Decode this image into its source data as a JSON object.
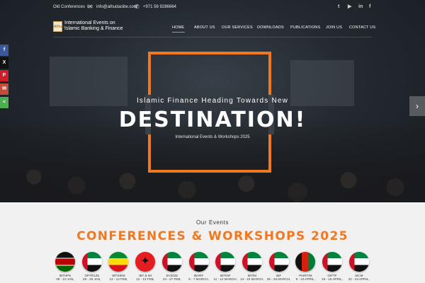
{
  "topbar": {
    "old_conferences": "Old Conferences",
    "old_conferences_caret": "⇩",
    "email": "info@alhudacibe.com",
    "phone": "+971 56 9286664",
    "social_icons": [
      "twitter-icon",
      "youtube-icon",
      "linkedin-icon",
      "facebook-icon"
    ],
    "social_glyphs": [
      "t",
      "▶",
      "in",
      "f"
    ]
  },
  "header": {
    "logo_text": "AlHuda",
    "title_line1": "International Events on",
    "title_line2": "Islamic Banking & Finance"
  },
  "nav": {
    "items": [
      "HOME",
      "ABOUT US",
      "OUR SERVICES",
      "DOWNLOADS",
      "PUBLICATIONS",
      "JOIN US",
      "CONTACT US"
    ],
    "active": "HOME"
  },
  "share": {
    "items": [
      {
        "icon": "facebook-icon",
        "glyph": "f",
        "color": "#3b5998"
      },
      {
        "icon": "x-twitter-icon",
        "glyph": "X",
        "color": "#111111"
      },
      {
        "icon": "pinterest-icon",
        "glyph": "P",
        "color": "#cb2027"
      },
      {
        "icon": "email-icon",
        "glyph": "✉",
        "color": "#c44c3a"
      },
      {
        "icon": "share-icon",
        "glyph": "<",
        "color": "#4caf50"
      }
    ]
  },
  "hero": {
    "subtitle": "Islamic Finance Heading Towards New",
    "title": "DESTINATION!",
    "caption": "International Events & Workshops 2025",
    "next_arrow": "›"
  },
  "events": {
    "kicker": "Our Events",
    "title": "CONFERENCES & WORKSHOPS 2025",
    "items": [
      {
        "code": "IBTHPS",
        "date": "09 - 10 JAN,",
        "flag": "kenya"
      },
      {
        "code": "OPTR125",
        "date": "28 - 29 JAN,",
        "flag": "uae"
      },
      {
        "code": "IBTSIEM",
        "date": "13 - 14 FEB,",
        "flag": "eth"
      },
      {
        "code": "IBT & IM",
        "date": "12 - 13 FEB,",
        "flag": "alb"
      },
      {
        "code": "EV2025",
        "date": "24 - 27 FEB,",
        "flag": "uae"
      },
      {
        "code": "IBARF",
        "date": "6 - 7 MARCH,",
        "flag": "uae"
      },
      {
        "code": "IBTINF",
        "date": "11 - 12 MARCH,",
        "flag": "uae"
      },
      {
        "code": "IBTIM",
        "date": "14 - 15 MARCH,",
        "flag": "uae"
      },
      {
        "code": "IBF",
        "date": "25 - 26 MARCH,",
        "flag": "uae"
      },
      {
        "code": "PAIRTIM",
        "date": "9 - 10 APRIL,",
        "flag": "afg"
      },
      {
        "code": "GIFTF",
        "date": "15 - 16 APRIL,",
        "flag": "uae"
      },
      {
        "code": "SICM",
        "date": "22 - 23 APRIL,",
        "flag": "uae"
      }
    ]
  },
  "colors": {
    "accent": "#f07820"
  }
}
